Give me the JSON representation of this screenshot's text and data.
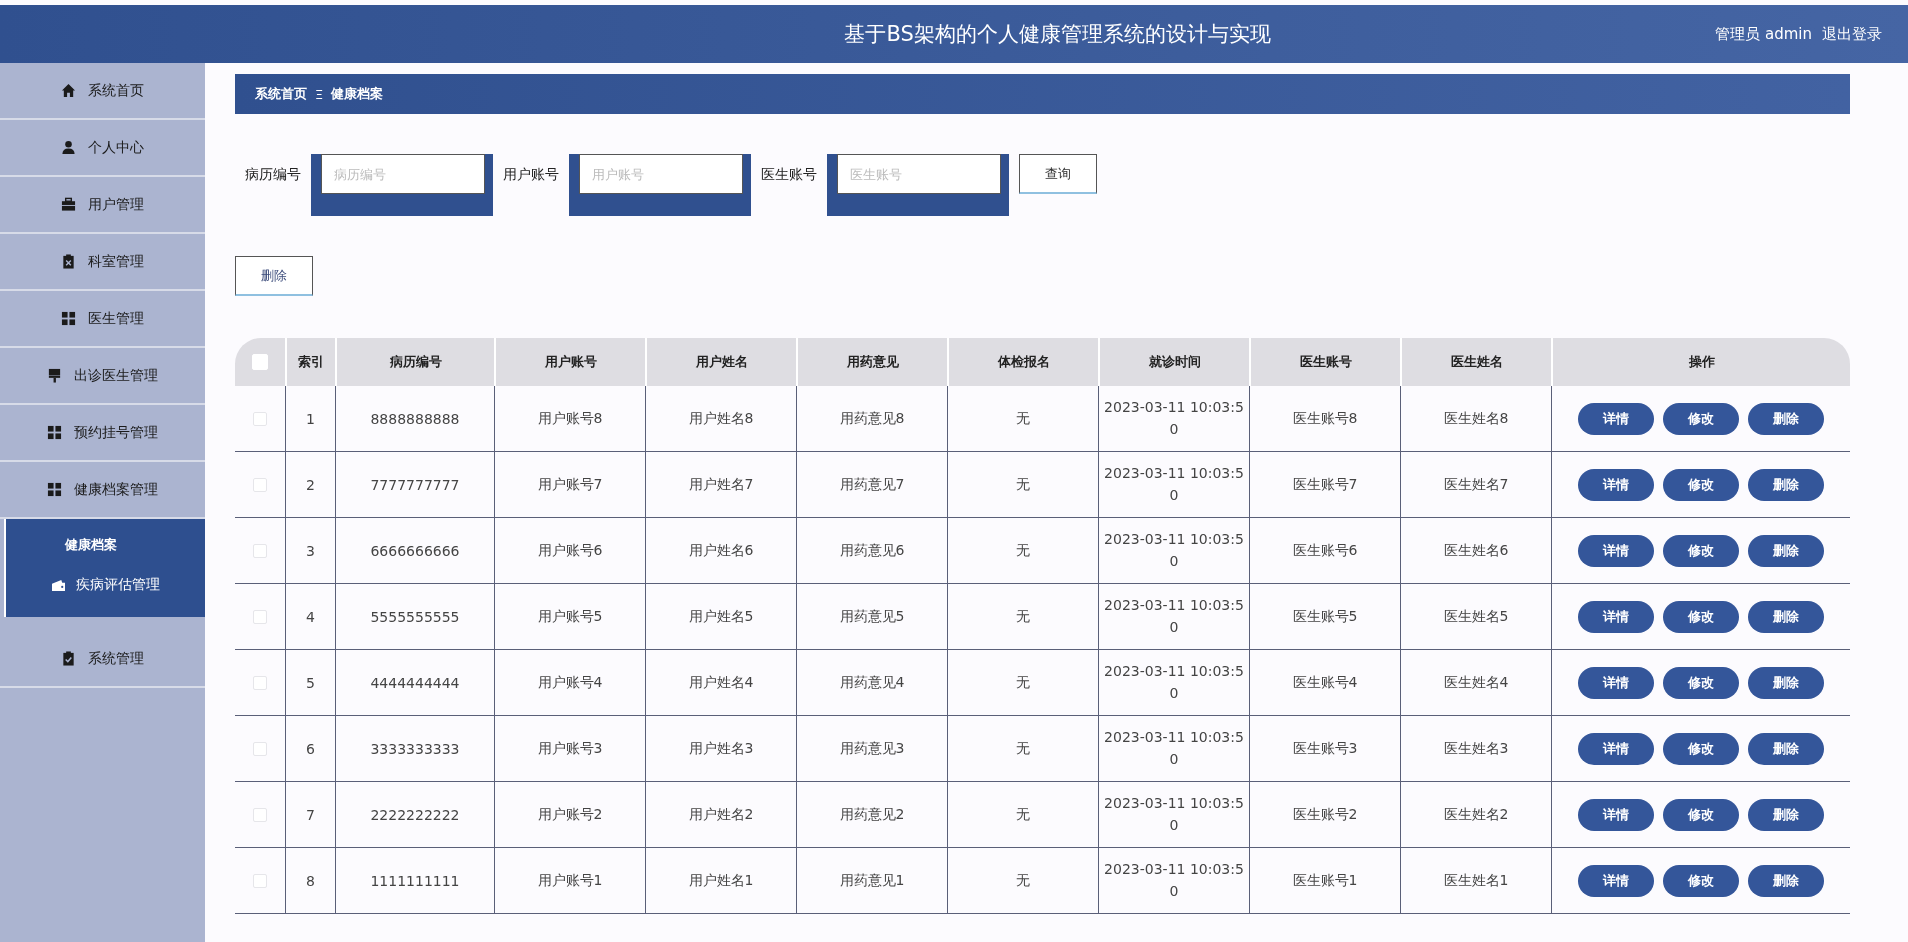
{
  "header": {
    "title": "基于BS架构的个人健康管理系统的设计与实现",
    "user_label": "管理员 admin",
    "logout": "退出登录"
  },
  "sidebar": {
    "items": [
      {
        "label": "系统首页"
      },
      {
        "label": "个人中心"
      },
      {
        "label": "用户管理"
      },
      {
        "label": "科室管理"
      },
      {
        "label": "医生管理"
      },
      {
        "label": "出诊医生管理"
      },
      {
        "label": "预约挂号管理"
      },
      {
        "label": "健康档案管理",
        "expanded": true,
        "children": [
          {
            "label": "健康档案",
            "selected": true
          },
          {
            "label": "疾病评估管理",
            "selected": false
          }
        ]
      },
      {
        "label": "系统管理"
      }
    ]
  },
  "breadcrumb": {
    "items": [
      "系统首页",
      "健康档案"
    ],
    "separator": "Ξ"
  },
  "search": {
    "fields": [
      {
        "label": "病历编号",
        "placeholder": "病历编号"
      },
      {
        "label": "用户账号",
        "placeholder": "用户账号"
      },
      {
        "label": "医生账号",
        "placeholder": "医生账号"
      }
    ],
    "button": "查询"
  },
  "delete_button": "删除",
  "table": {
    "header_checked": false,
    "columns": [
      "索引",
      "病历编号",
      "用户账号",
      "用户姓名",
      "用药意见",
      "体检报名",
      "就诊时间",
      "医生账号",
      "医生姓名",
      "操作"
    ],
    "rows": [
      {
        "checked": false,
        "cells": [
          "1",
          "8888888888",
          "用户账号8",
          "用户姓名8",
          "用药意见8",
          "无",
          "2023-03-11 10:03:50",
          "医生账号8",
          "医生姓名8"
        ],
        "actions": [
          "详情",
          "修改",
          "删除"
        ]
      },
      {
        "checked": false,
        "cells": [
          "2",
          "7777777777",
          "用户账号7",
          "用户姓名7",
          "用药意见7",
          "无",
          "2023-03-11 10:03:50",
          "医生账号7",
          "医生姓名7"
        ],
        "actions": [
          "详情",
          "修改",
          "删除"
        ]
      },
      {
        "checked": false,
        "cells": [
          "3",
          "6666666666",
          "用户账号6",
          "用户姓名6",
          "用药意见6",
          "无",
          "2023-03-11 10:03:50",
          "医生账号6",
          "医生姓名6"
        ],
        "actions": [
          "详情",
          "修改",
          "删除"
        ]
      },
      {
        "checked": false,
        "cells": [
          "4",
          "5555555555",
          "用户账号5",
          "用户姓名5",
          "用药意见5",
          "无",
          "2023-03-11 10:03:50",
          "医生账号5",
          "医生姓名5"
        ],
        "actions": [
          "详情",
          "修改",
          "删除"
        ]
      },
      {
        "checked": false,
        "cells": [
          "5",
          "4444444444",
          "用户账号4",
          "用户姓名4",
          "用药意见4",
          "无",
          "2023-03-11 10:03:50",
          "医生账号4",
          "医生姓名4"
        ],
        "actions": [
          "详情",
          "修改",
          "删除"
        ]
      },
      {
        "checked": false,
        "cells": [
          "6",
          "3333333333",
          "用户账号3",
          "用户姓名3",
          "用药意见3",
          "无",
          "2023-03-11 10:03:50",
          "医生账号3",
          "医生姓名3"
        ],
        "actions": [
          "详情",
          "修改",
          "删除"
        ]
      },
      {
        "checked": false,
        "cells": [
          "7",
          "2222222222",
          "用户账号2",
          "用户姓名2",
          "用药意见2",
          "无",
          "2023-03-11 10:03:50",
          "医生账号2",
          "医生姓名2"
        ],
        "actions": [
          "详情",
          "修改",
          "删除"
        ]
      },
      {
        "checked": false,
        "cells": [
          "8",
          "1111111111",
          "用户账号1",
          "用户姓名1",
          "用药意见1",
          "无",
          "2023-03-11 10:03:50",
          "医生账号1",
          "医生姓名1"
        ],
        "actions": [
          "详情",
          "修改",
          "删除"
        ]
      }
    ]
  }
}
